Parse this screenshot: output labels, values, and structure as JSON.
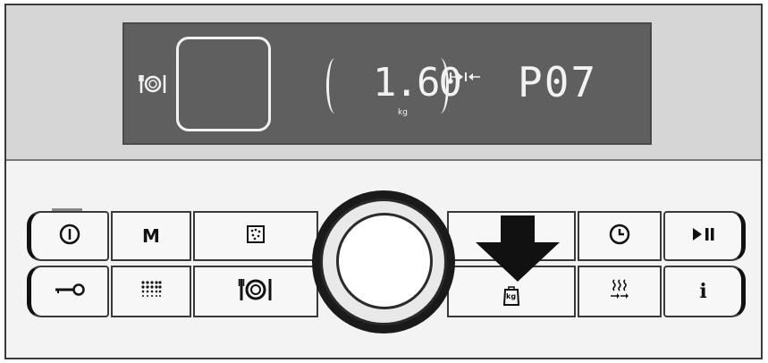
{
  "display": {
    "weight_value": "1.60",
    "weight_unit": "kg",
    "program_code": "P07",
    "icons": [
      "dish-icon",
      "time-range-icon"
    ]
  },
  "buttons": {
    "top_row": [
      {
        "name": "power-button",
        "icon": "power-icon"
      },
      {
        "name": "menu-button",
        "label": "M"
      },
      {
        "name": "dishwasher-tray-button",
        "icon": "tray-dots-icon"
      },
      {
        "name": "blank-button"
      },
      {
        "name": "timer-button",
        "icon": "clock-icon"
      },
      {
        "name": "start-pause-button",
        "icon": "play-pause-icon"
      }
    ],
    "bottom_row": [
      {
        "name": "child-lock-button",
        "icon": "key-icon"
      },
      {
        "name": "intensive-zone-button",
        "icon": "dot-grid-icon"
      },
      {
        "name": "dishes-button",
        "icon": "dish-icon"
      },
      {
        "name": "load-weight-button",
        "icon": "weight-kg-icon",
        "label": "kg"
      },
      {
        "name": "drying-button",
        "icon": "steam-arrows-icon"
      },
      {
        "name": "info-button",
        "label": "i"
      }
    ]
  },
  "colors": {
    "lcd_background": "#5f5f5f",
    "lcd_text": "#f2f2f2",
    "panel_upper": "#d6d6d6",
    "panel_lower": "#f3f3f3"
  }
}
